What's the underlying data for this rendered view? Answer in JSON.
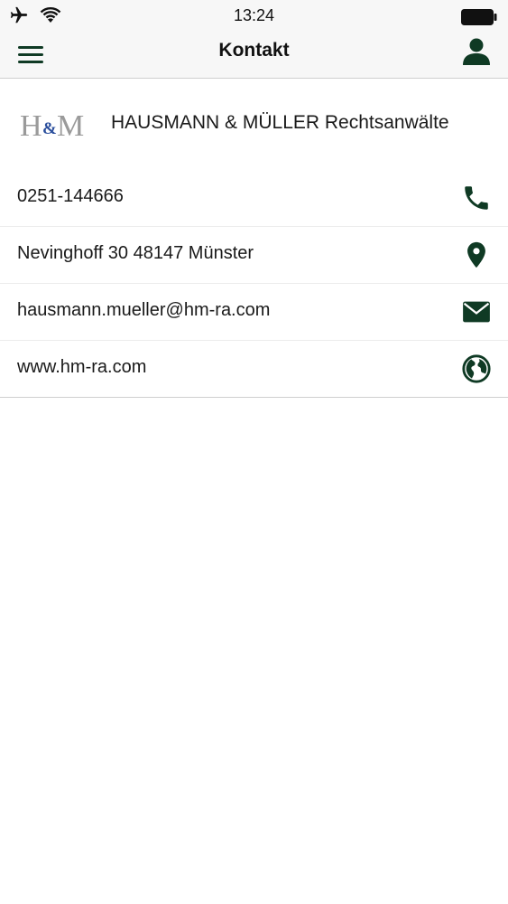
{
  "status_bar": {
    "time": "13:24"
  },
  "nav": {
    "title": "Kontakt"
  },
  "brand": {
    "logo_text": "H&M",
    "name": "HAUSMANN & MÜLLER Rechtsanwälte"
  },
  "contacts": [
    {
      "value": "0251-144666",
      "icon": "phone-icon"
    },
    {
      "value": "Nevinghoff 30 48147 Münster",
      "icon": "location-pin-icon"
    },
    {
      "value": "hausmann.mueller@hm-ra.com",
      "icon": "mail-icon"
    },
    {
      "value": "www.hm-ra.com",
      "icon": "globe-icon"
    }
  ],
  "colors": {
    "accent": "#0f3a24",
    "bar_background": "#f7f7f7",
    "divider": "#cfcfcf",
    "logo_grey": "#9a9a9a",
    "logo_blue": "#2a4e9c"
  }
}
